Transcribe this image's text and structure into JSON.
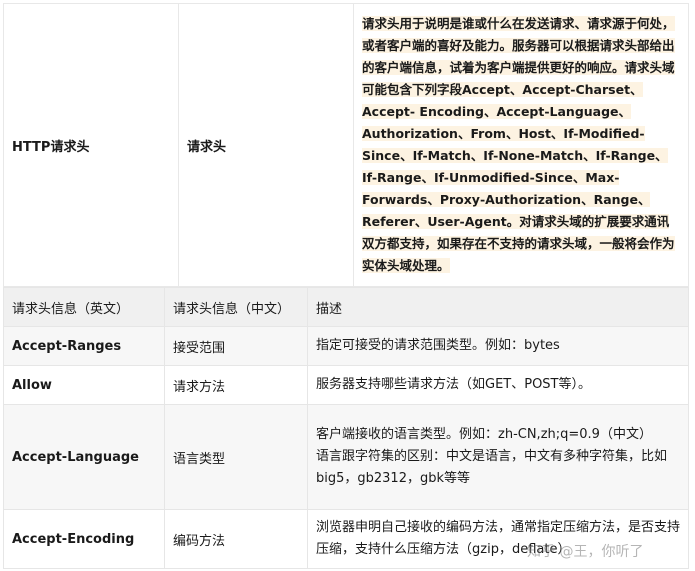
{
  "top_table": {
    "name": "HTTP请求头",
    "name_cn": "请求头",
    "description": "请求头用于说明是谁或什么在发送请求、请求源于何处，或者客户端的喜好及能力。服务器可以根据请求头部给出的客户端信息，试着为客户端提供更好的响应。请求头域可能包含下列字段Accept、Accept-Charset、Accept- Encoding、Accept-Language、Authorization、From、Host、If-Modified-Since、If-Match、If-None-Match、If-Range、If-Range、If-Unmodified-Since、Max-Forwards、Proxy-Authorization、Range、Referer、User-Agent。对请求头域的扩展要求通讯双方都支持，如果存在不支持的请求头域，一般将会作为实体头域处理。"
  },
  "bottom_table": {
    "headers": [
      "请求头信息（英文）",
      "请求头信息（中文）",
      "描述"
    ],
    "rows": [
      {
        "en": "Accept-Ranges",
        "cn": "接受范围",
        "desc": "指定可接受的请求范围类型。例如：bytes"
      },
      {
        "en": "Allow",
        "cn": "请求方法",
        "desc": "服务器支持哪些请求方法（如GET、POST等）。"
      },
      {
        "en": "Accept-Language",
        "cn": "语言类型",
        "desc": "客户端接收的语言类型。例如：zh-CN,zh;q=0.9（中文）",
        "desc2": "语言跟字符集的区别：中文是语言，中文有多种字符集，比如big5，gb2312，gbk等等"
      },
      {
        "en": "Accept-Encoding",
        "cn": "编码方法",
        "desc": "浏览器申明自己接收的编码方法，通常指定压缩方法，是否支持压缩，支持什么压缩方法（gzip，deflate）"
      }
    ]
  },
  "watermark": "知乎 @王，你听了"
}
